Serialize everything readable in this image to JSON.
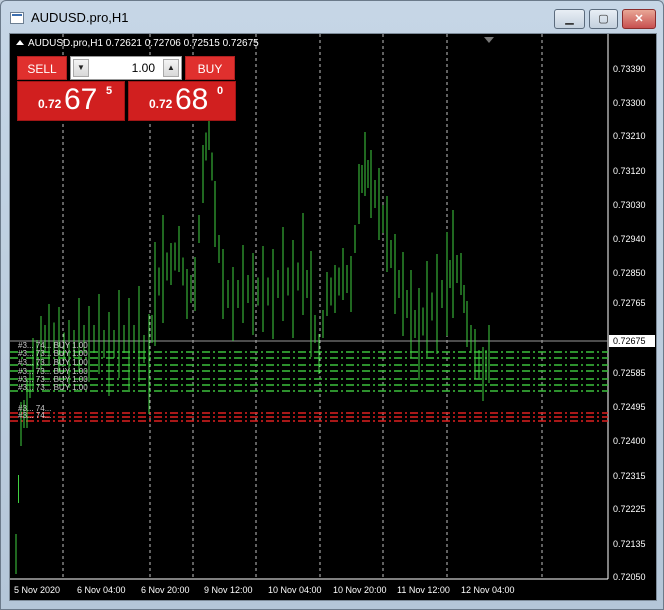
{
  "window": {
    "title": "AUDUSD.pro,H1",
    "min_glyph": "▁",
    "max_glyph": "▢",
    "close_glyph": "✕"
  },
  "chart": {
    "header": "AUDUSD.pro,H1  0.72621 0.72706 0.72515 0.72675",
    "current_price": "0.72675",
    "y_labels": [
      "0.73390",
      "0.73300",
      "0.73210",
      "0.73120",
      "0.73030",
      "0.72940",
      "0.72850",
      "0.72765",
      "0.72675",
      "0.72585",
      "0.72495",
      "0.72400",
      "0.72315",
      "0.72225",
      "0.72135",
      "0.72050"
    ],
    "x_labels": [
      "5 Nov 2020",
      "6 Nov 04:00",
      "6 Nov 20:00",
      "9 Nov 12:00",
      "10 Nov 04:00",
      "10 Nov 20:00",
      "11 Nov 12:00",
      "12 Nov 04:00"
    ],
    "order_labels": [
      "#3... 74... BUY 1.00",
      "#3... 73... BUY 1.00",
      "#3... 73... BUY 1.00",
      "#3... 73... BUY 1.00",
      "#3... 73... BUY 1.00",
      "#3... 73... BUY 1.00",
      "#3... 74...",
      "#3... 74..."
    ],
    "colors": {
      "background": "#000000",
      "bars": "#40d040",
      "grid": "#c0c0c0",
      "buy_lines": "#3cbf3c",
      "sl_lines": "#e02020"
    }
  },
  "trade_panel": {
    "sell_label": "SELL",
    "buy_label": "BUY",
    "lot": "1.00",
    "lot_down_glyph": "▼",
    "lot_up_glyph": "▲",
    "sell_price": {
      "small": "0.72",
      "big": "67",
      "sup": "5"
    },
    "buy_price": {
      "small": "0.72",
      "big": "68",
      "sup": "0"
    }
  }
}
